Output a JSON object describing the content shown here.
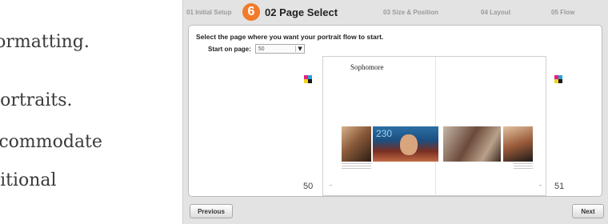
{
  "document": {
    "lines": [
      "formatting.",
      "portraits.",
      "ccommodate",
      "ditional"
    ]
  },
  "wizard": {
    "steps": [
      {
        "number": "01",
        "label": "01 Initial Setup"
      },
      {
        "number": "6",
        "label": "02 Page Select",
        "active": true
      },
      {
        "number": "03",
        "label": "03 Size & Position"
      },
      {
        "number": "04",
        "label": "04 Layout"
      },
      {
        "number": "05",
        "label": "05 Flow"
      }
    ],
    "instruction": "Select the page where you want your portrait flow to start.",
    "start_label": "Start on page:",
    "start_page_value": "50",
    "spread": {
      "section_title": "Sophomore",
      "photo_number": "230",
      "left_page_number": "50",
      "right_page_number": "51"
    },
    "buttons": {
      "previous": "Previous",
      "next": "Next"
    },
    "colors": {
      "accent": "#f07c2a",
      "panel": "#ffffff",
      "chrome": "#e3e3e3"
    }
  }
}
